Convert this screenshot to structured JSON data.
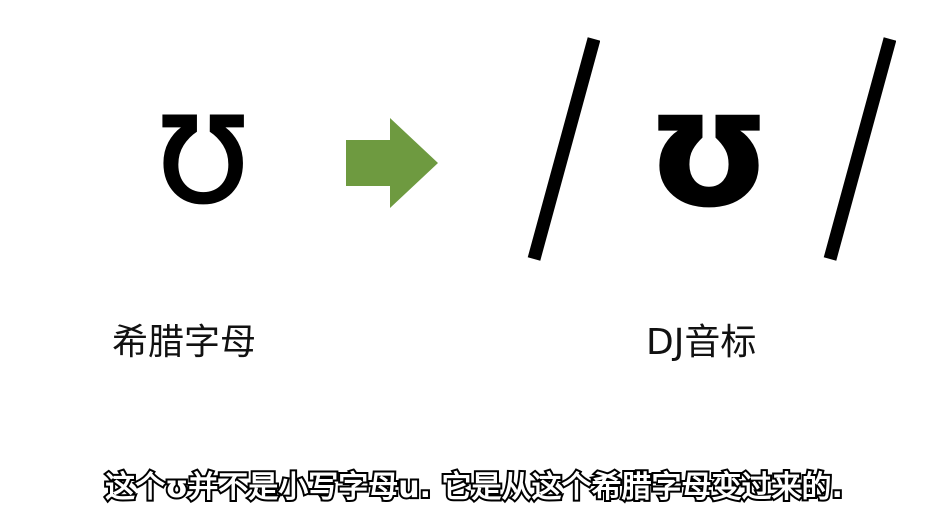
{
  "greek_letter": "ʊ",
  "ipa_symbol": "ʊ",
  "labels": {
    "greek": "希腊字母",
    "dj": "DJ音标"
  },
  "subtitle": "这个ʊ并不是小写字母u. 它是从这个希腊字母变过来的.",
  "colors": {
    "arrow": "#6e9a40",
    "text": "#000000",
    "subtitle_fill": "#ffffff",
    "subtitle_stroke": "#000000"
  },
  "icons": {
    "arrow": "arrow-right-icon"
  }
}
